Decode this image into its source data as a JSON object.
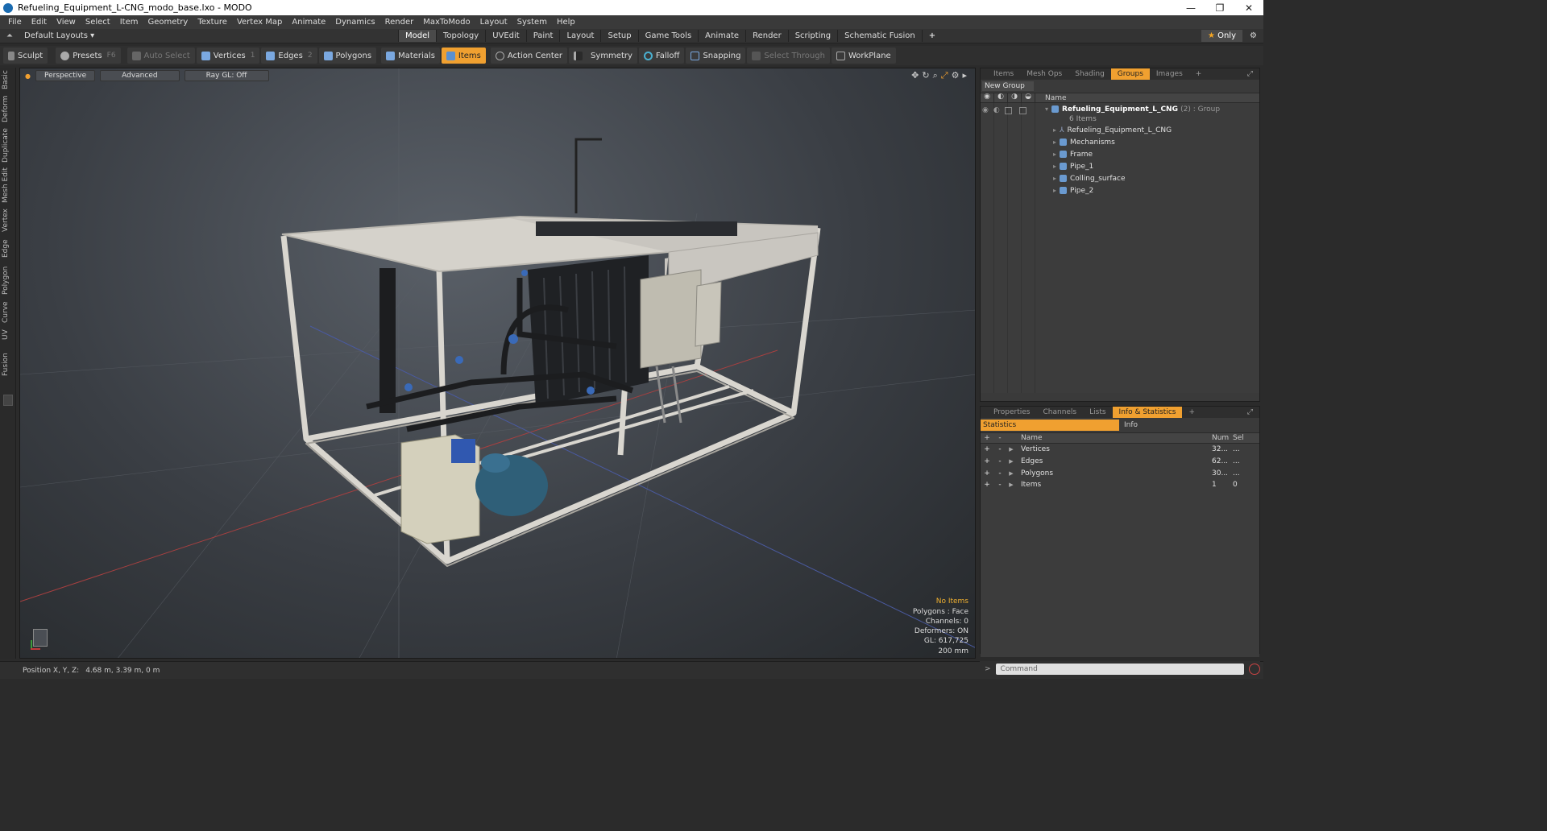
{
  "window": {
    "title": "Refueling_Equipment_L-CNG_modo_base.lxo - MODO",
    "controls": [
      "—",
      "❐",
      "✕"
    ]
  },
  "menubar": [
    "File",
    "Edit",
    "View",
    "Select",
    "Item",
    "Geometry",
    "Texture",
    "Vertex Map",
    "Animate",
    "Dynamics",
    "Render",
    "MaxToModo",
    "Layout",
    "System",
    "Help"
  ],
  "layoutbar": {
    "layout_selector": "Default Layouts ▾",
    "tabs": [
      "Model",
      "Topology",
      "UVEdit",
      "Paint",
      "Layout",
      "Setup",
      "Game Tools",
      "Animate",
      "Render",
      "Scripting",
      "Schematic Fusion",
      "+"
    ],
    "active_tab": "Model",
    "only_label": "Only"
  },
  "toolbar": {
    "sculpt": "Sculpt",
    "presets": "Presets",
    "presets_shortcut": "F6",
    "auto_select": "Auto Select",
    "vertices": "Vertices",
    "vertices_shortcut": "1",
    "edges": "Edges",
    "edges_shortcut": "2",
    "polygons": "Polygons",
    "materials": "Materials",
    "items": "Items",
    "action_center": "Action Center",
    "symmetry": "Symmetry",
    "falloff": "Falloff",
    "snapping": "Snapping",
    "select_through": "Select Through",
    "workplane": "WorkPlane"
  },
  "left_tabs": [
    "Basic",
    "Deform",
    "Duplicate",
    "Mesh Edit",
    "Vertex",
    "Edge",
    "Polygon",
    "Curve",
    "UV",
    "Fusion"
  ],
  "viewport": {
    "view_mode": "Perspective",
    "shading": "Advanced",
    "raygl": "Ray GL: Off",
    "info": {
      "selection": "No Items",
      "polygons": "Polygons : Face",
      "channels": "Channels: 0",
      "deformers": "Deformers: ON",
      "gl": "GL: 617,725",
      "scale": "200 mm"
    }
  },
  "statusbar": {
    "label": "Position X, Y, Z:",
    "value": "4.68 m, 3.39 m, 0 m"
  },
  "groups_panel": {
    "tabs": [
      "Items",
      "Mesh Ops",
      "Shading",
      "Groups",
      "Images",
      "+"
    ],
    "active_tab": "Groups",
    "new_group": "New Group",
    "name_header": "Name",
    "root": {
      "name": "Refueling_Equipment_L_CNG",
      "suffix": "(2) : Group",
      "count": "6 Items"
    },
    "children": [
      "Refueling_Equipment_L_CNG",
      "Mechanisms",
      "Frame",
      "Pipe_1",
      "Colling_surface",
      "Pipe_2"
    ]
  },
  "stats_panel": {
    "tabs": [
      "Properties",
      "Channels",
      "Lists",
      "Info & Statistics",
      "+"
    ],
    "active_tab": "Info & Statistics",
    "subtabs": [
      "Statistics",
      "Info"
    ],
    "headers": {
      "name": "Name",
      "num": "Num",
      "sel": "Sel"
    },
    "rows": [
      {
        "name": "Vertices",
        "num": "32...",
        "sel": "..."
      },
      {
        "name": "Edges",
        "num": "62...",
        "sel": "..."
      },
      {
        "name": "Polygons",
        "num": "30...",
        "sel": "..."
      },
      {
        "name": "Items",
        "num": "1",
        "sel": "0"
      }
    ]
  },
  "command": {
    "prompt": ">",
    "placeholder": "Command"
  },
  "colors": {
    "accent": "#f0a030",
    "background": "#2b2b2b"
  }
}
